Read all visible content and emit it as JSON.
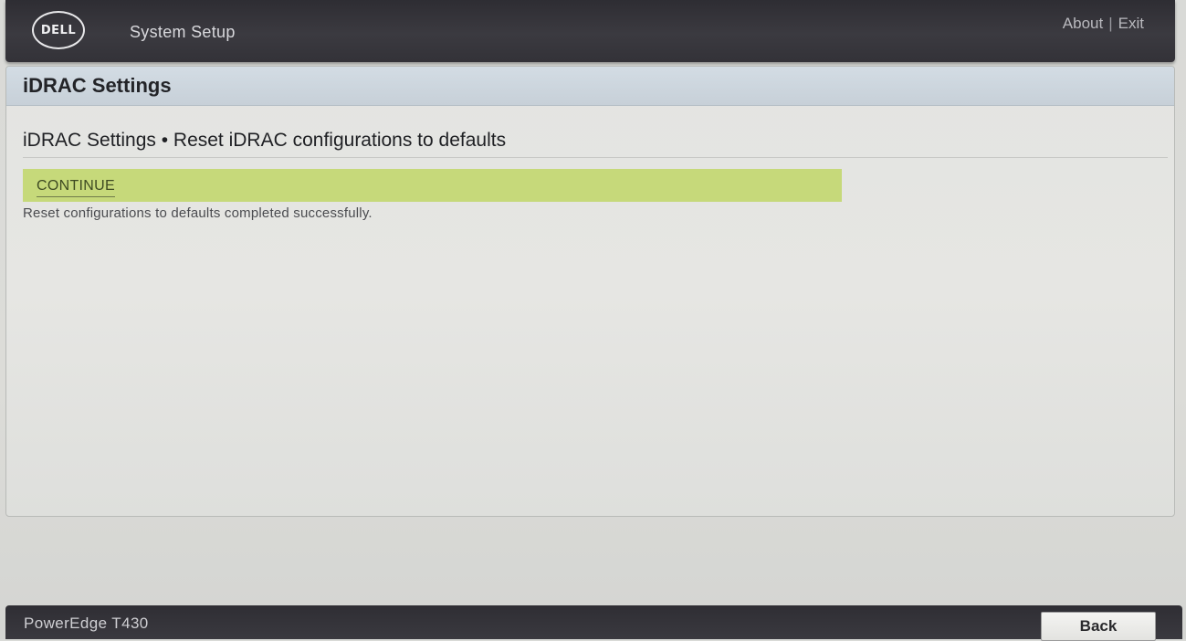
{
  "header": {
    "logo_text": "DELL",
    "app_title": "System Setup",
    "about_label": "About",
    "separator": "|",
    "exit_label": "Exit"
  },
  "panel": {
    "title": "iDRAC Settings",
    "page_heading": "iDRAC Settings • Reset iDRAC configurations to defaults",
    "continue_label": "CONTINUE",
    "status_message": "Reset configurations to defaults completed successfully."
  },
  "footer": {
    "model": "PowerEdge T430",
    "back_label": "Back"
  },
  "colors": {
    "header_bg": "#35343a",
    "panel_header_bg": "#ccd5dd",
    "highlight_row": "#c6d97a",
    "panel_bg": "#e4e5e2"
  }
}
